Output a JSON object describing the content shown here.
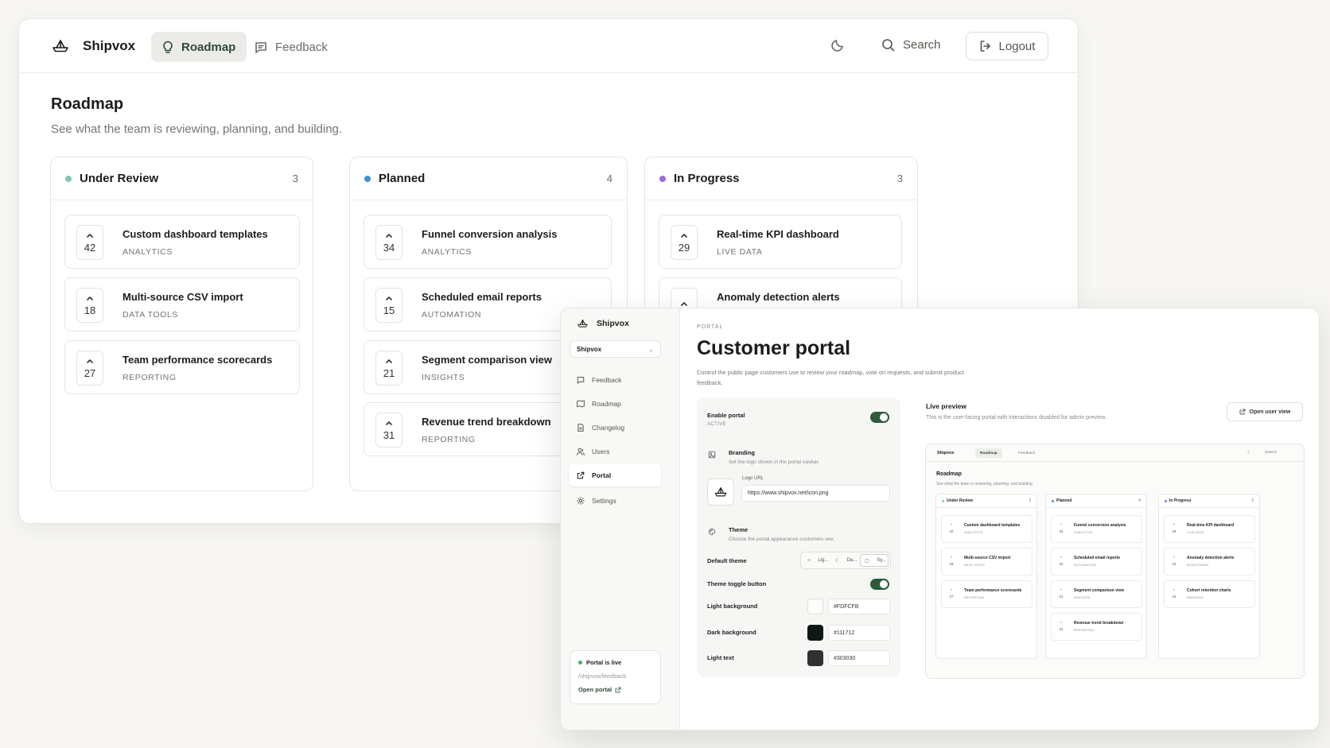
{
  "colors": {
    "under_review": "#7ec8b0",
    "planned": "#3b93d8",
    "in_progress": "#9b6bd8",
    "toggle_on": "#2d5b3a",
    "active_tab": "#2e4a36"
  },
  "back": {
    "brand": "Shipvox",
    "tabs": {
      "roadmap": "Roadmap",
      "feedback": "Feedback"
    },
    "search": "Search",
    "logout": "Logout",
    "title": "Roadmap",
    "subtitle": "See what the team is reviewing, planning, and building.",
    "columns": [
      {
        "title": "Under Review",
        "count": "3",
        "cards": [
          {
            "votes": "42",
            "title": "Custom dashboard templates",
            "category": "ANALYTICS"
          },
          {
            "votes": "18",
            "title": "Multi-source CSV import",
            "category": "DATA TOOLS"
          },
          {
            "votes": "27",
            "title": "Team performance scorecards",
            "category": "REPORTING"
          }
        ]
      },
      {
        "title": "Planned",
        "count": "4",
        "cards": [
          {
            "votes": "34",
            "title": "Funnel conversion analysis",
            "category": "ANALYTICS"
          },
          {
            "votes": "15",
            "title": "Scheduled email reports",
            "category": "AUTOMATION"
          },
          {
            "votes": "21",
            "title": "Segment comparison view",
            "category": "INSIGHTS"
          },
          {
            "votes": "31",
            "title": "Revenue trend breakdown",
            "category": "REPORTING"
          }
        ]
      },
      {
        "title": "In Progress",
        "count": "3",
        "cards": [
          {
            "votes": "29",
            "title": "Real-time KPI dashboard",
            "category": "LIVE DATA"
          },
          {
            "votes": "",
            "title": "Anomaly detection alerts",
            "category": ""
          }
        ]
      }
    ]
  },
  "front": {
    "brand": "Shipvox",
    "workspace": "Shipvox",
    "nav": [
      "Feedback",
      "Roadmap",
      "Changelog",
      "Users",
      "Portal",
      "Settings"
    ],
    "live_box": {
      "status": "Portal is live",
      "path": "/shipvox/feedback",
      "link": "Open portal"
    },
    "eyebrow": "PORTAL",
    "title": "Customer portal",
    "description": "Control the public page customers use to review your roadmap, vote on requests, and submit product feedback.",
    "settings": {
      "enable_label": "Enable portal",
      "enable_status": "ACTIVE",
      "branding_title": "Branding",
      "branding_sub": "Set the logo shown in the portal navbar.",
      "logo_label": "Logo URL",
      "logo_url": "https://www.shipvox.net/icon.png",
      "theme_title": "Theme",
      "theme_sub": "Choose the portal appearance customers see.",
      "default_theme_label": "Default theme",
      "theme_options": [
        "Lig...",
        "Da...",
        "Sy..."
      ],
      "theme_toggle_label": "Theme toggle button",
      "light_bg_label": "Light background",
      "light_bg": "#FDFCFB",
      "dark_bg_label": "Dark background",
      "dark_bg": "#111712",
      "light_text_label": "Light text",
      "light_text": "#303030"
    },
    "live_preview": {
      "title": "Live preview",
      "subtitle": "This is the user-facing portal with interactions disabled for admin preview.",
      "open_user_view": "Open user view",
      "nav": {
        "brand": "Shipvox",
        "roadmap": "Roadmap",
        "feedback": "Feedback",
        "search": "Search"
      },
      "title_text": "Roadmap",
      "subtitle_text": "See what the team is reviewing, planning, and building.",
      "columns": [
        {
          "title": "Under Review",
          "count": "3",
          "cards": [
            {
              "votes": "42",
              "title": "Custom dashboard templates",
              "category": "ANALYTICS"
            },
            {
              "votes": "18",
              "title": "Multi-source CSV import",
              "category": "DATA TOOLS"
            },
            {
              "votes": "27",
              "title": "Team performance scorecards",
              "category": "REPORTING"
            }
          ]
        },
        {
          "title": "Planned",
          "count": "4",
          "cards": [
            {
              "votes": "34",
              "title": "Funnel conversion analysis",
              "category": "ANALYTICS"
            },
            {
              "votes": "15",
              "title": "Scheduled email reports",
              "category": "AUTOMATION"
            },
            {
              "votes": "21",
              "title": "Segment comparison view",
              "category": "INSIGHTS"
            },
            {
              "votes": "31",
              "title": "Revenue trend breakdown",
              "category": "REPORTING"
            }
          ]
        },
        {
          "title": "In Progress",
          "count": "3",
          "cards": [
            {
              "votes": "29",
              "title": "Real-time KPI dashboard",
              "category": "LIVE DATA"
            },
            {
              "votes": "16",
              "title": "Anomaly detection alerts",
              "category": "MONITORING"
            },
            {
              "votes": "24",
              "title": "Cohort retention charts",
              "category": "INSIGHTS"
            }
          ]
        }
      ]
    }
  }
}
